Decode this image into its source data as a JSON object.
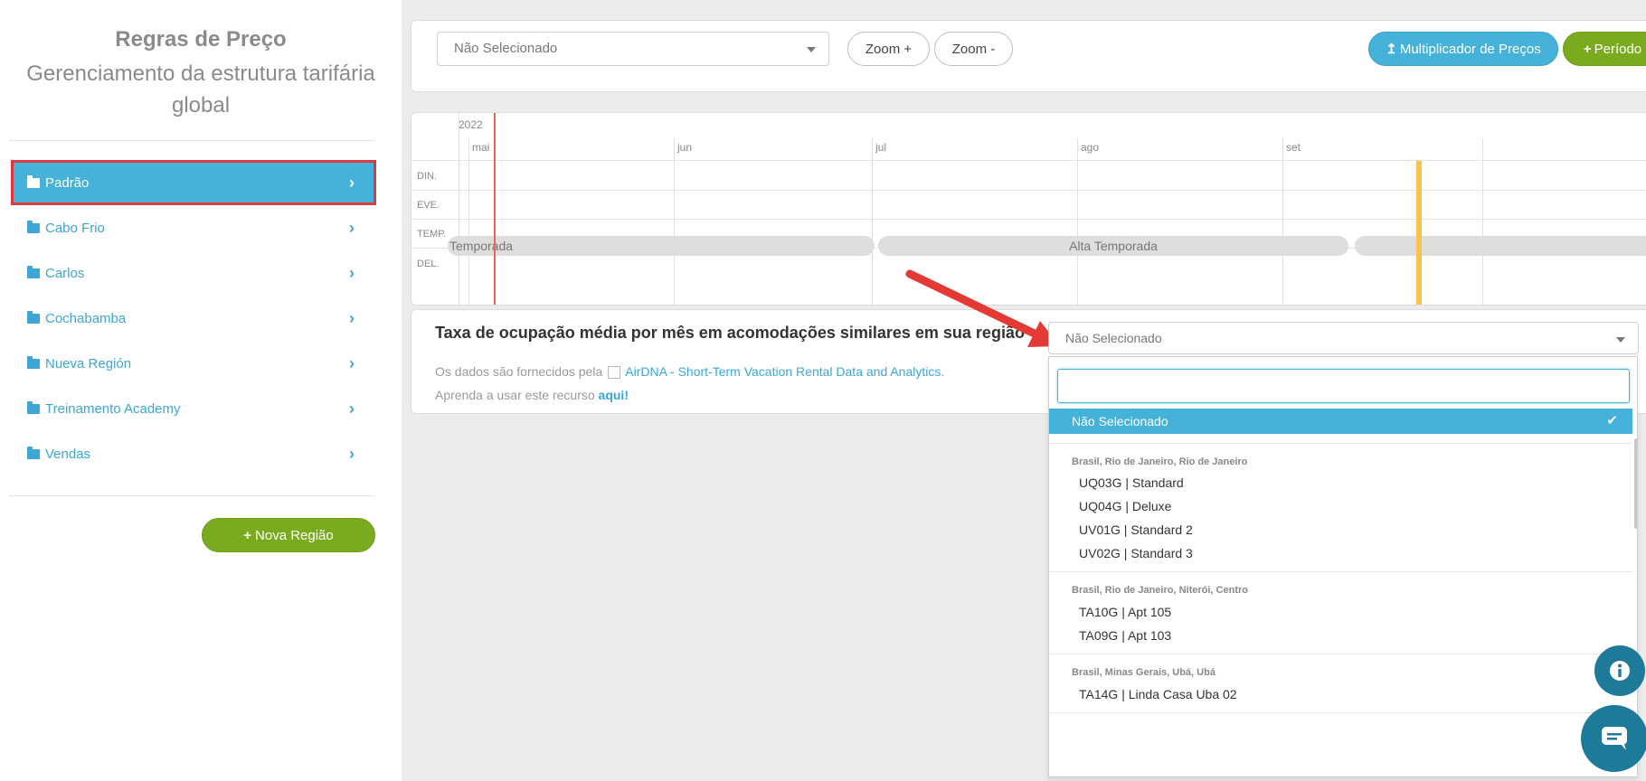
{
  "sidebar": {
    "title": "Regras de Preço",
    "subtitle": "Gerenciamento da estrutura tarifária global",
    "items": [
      {
        "label": "Padrão"
      },
      {
        "label": "Cabo Frio"
      },
      {
        "label": "Carlos"
      },
      {
        "label": "Cochabamba"
      },
      {
        "label": "Nueva Región"
      },
      {
        "label": "Treinamento Academy"
      },
      {
        "label": "Vendas"
      }
    ],
    "new_region_button": "Nova Região"
  },
  "toolbar": {
    "select_value": "Não Selecionado",
    "zoom_in": "Zoom +",
    "zoom_out": "Zoom -",
    "multiplier_button": "Multiplicador de Preços",
    "period_button": "Período"
  },
  "timeline": {
    "year": "2022",
    "months": [
      "mai",
      "jun",
      "jul",
      "ago",
      "set"
    ],
    "rows": [
      "DIN.",
      "EVE.",
      "TEMP.",
      "DEL."
    ],
    "seasons": [
      "Temporada",
      "Alta Temporada"
    ]
  },
  "occupancy": {
    "title": "Taxa de ocupação média por mês em acomodações similares em sua região",
    "source_prefix": "Os dados são fornecidos pela",
    "source_link": "AirDNA - Short-Term Vacation Rental Data and Analytics",
    "learn_prefix": "Aprenda a usar este recurso",
    "learn_link": "aqui!",
    "select_value": "Não Selecionado"
  },
  "dropdown": {
    "search_value": "",
    "selected": "Não Selecionado",
    "groups": [
      {
        "label": "Brasil, Rio de Janeiro, Rio de Janeiro",
        "options": [
          "UQ03G | Standard",
          "UQ04G | Deluxe",
          "UV01G | Standard 2",
          "UV02G | Standard 3"
        ]
      },
      {
        "label": "Brasil, Rio de Janeiro, Niterói, Centro",
        "options": [
          "TA10G | Apt 105",
          "TA09G | Apt 103"
        ]
      },
      {
        "label": "Brasil, Minas Gerais, Ubá, Ubá",
        "options": [
          "TA14G | Linda Casa Uba 02"
        ]
      }
    ]
  },
  "colors": {
    "accent_blue": "#45b2d9",
    "accent_green": "#7aab1f",
    "highlight_red": "#e0393b",
    "marker_yellow": "#f6c451"
  },
  "icons": [
    "folder-open-icon",
    "folder-icon",
    "chevron-right-icon",
    "plus-icon",
    "upload-icon",
    "check-icon",
    "info-icon",
    "chat-icon",
    "arrow-annotation"
  ]
}
